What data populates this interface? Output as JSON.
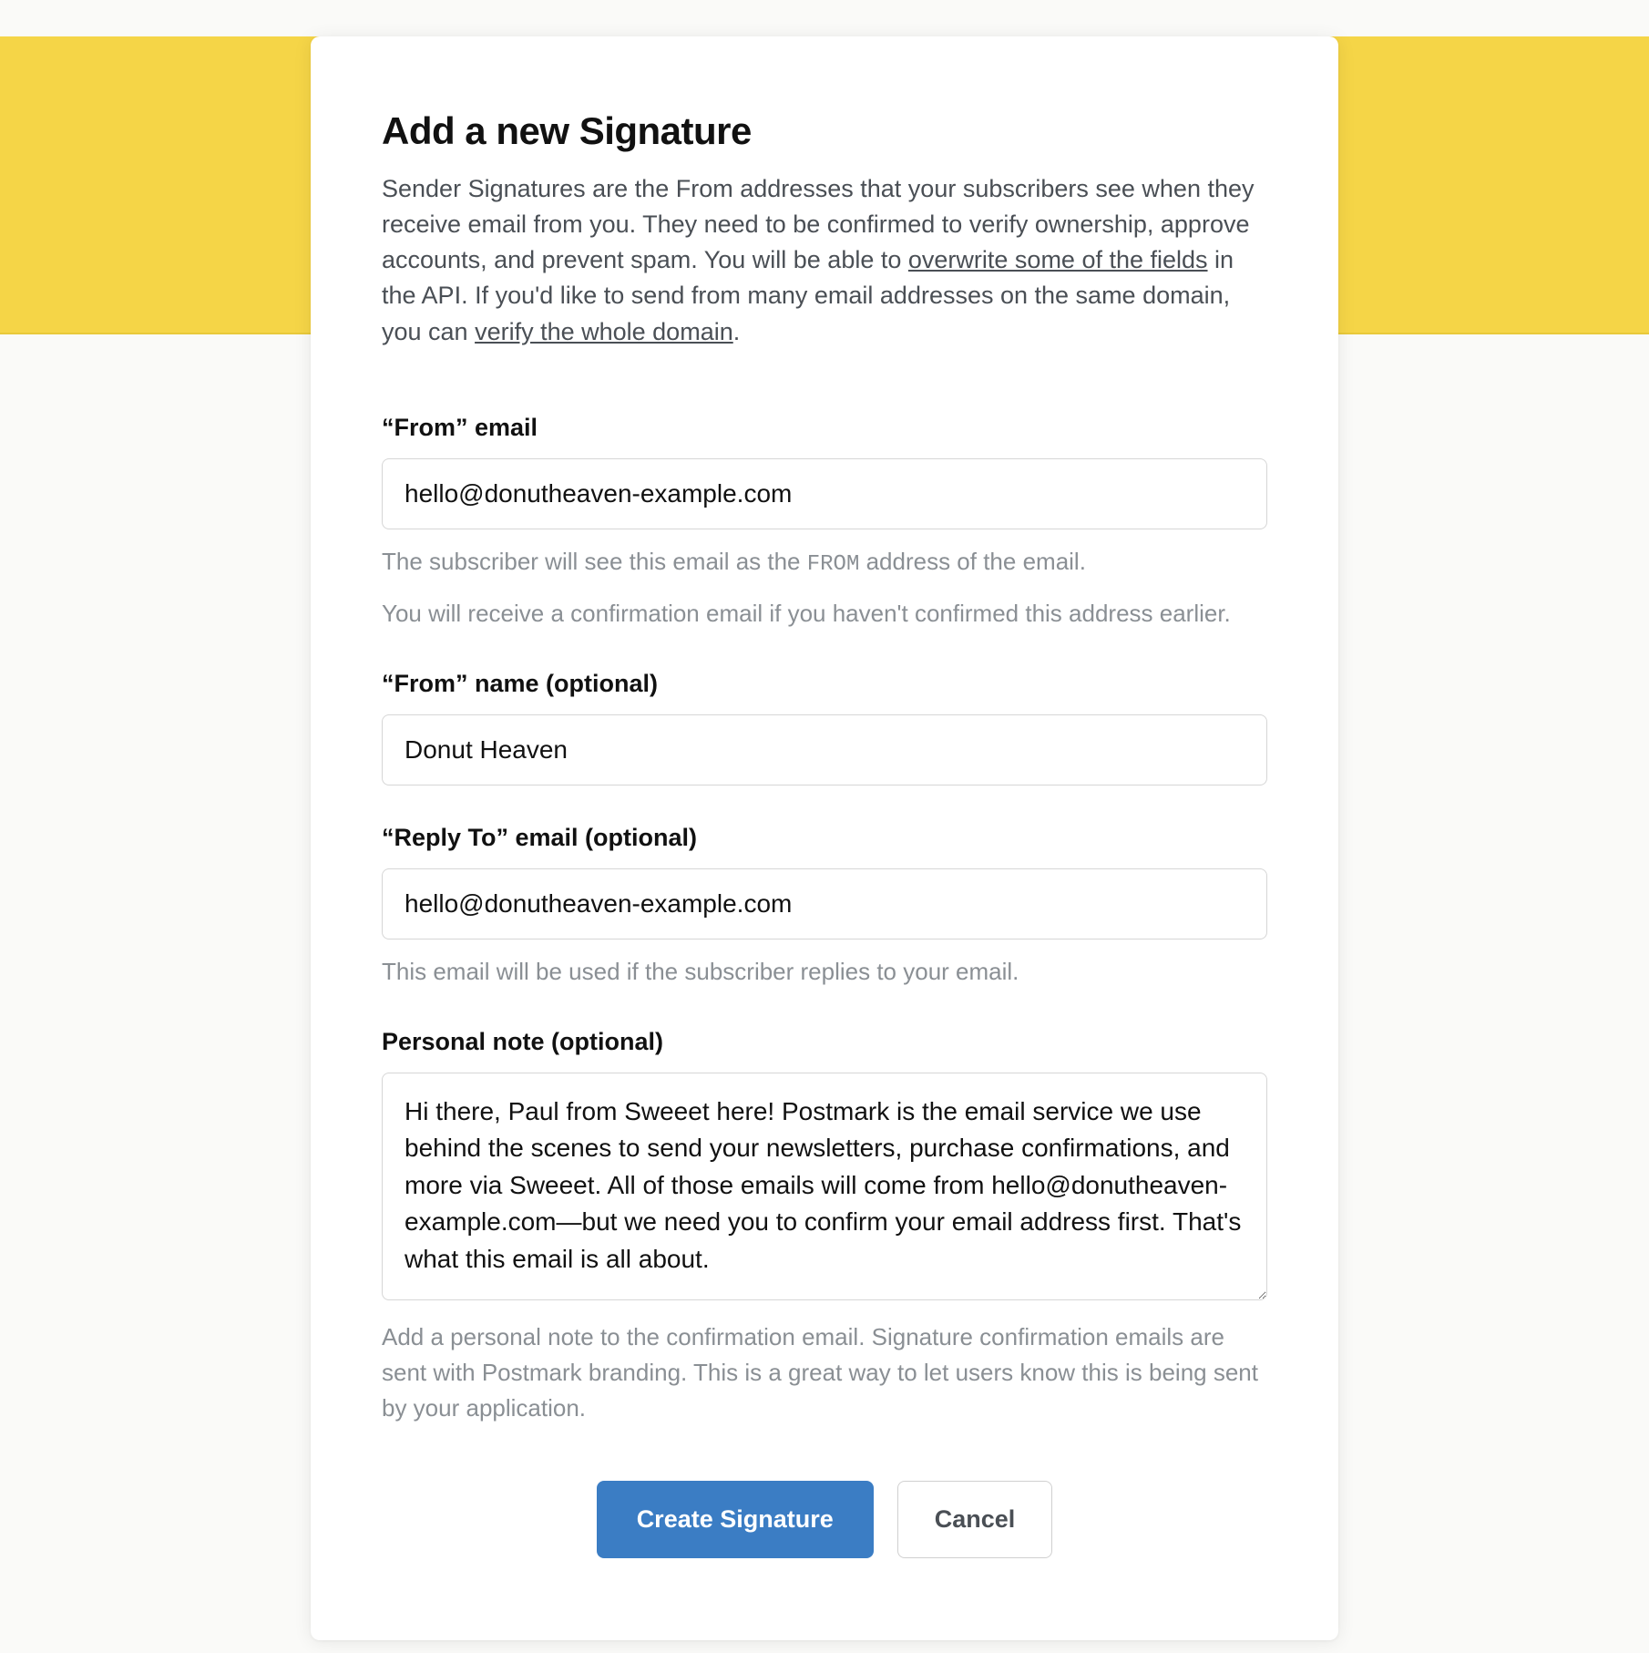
{
  "header": {
    "title": "Add a new Signature",
    "intro_prefix": "Sender Signatures are the From addresses that your subscribers see when they receive email from you. They need to be confirmed to verify ownership, approve accounts, and prevent spam. You will be able to ",
    "intro_link1": "overwrite some of the fields",
    "intro_mid": " in the API. If you'd like to send from many email addresses on the same domain, you can ",
    "intro_link2": "verify the whole domain",
    "intro_suffix": "."
  },
  "fields": {
    "from_email": {
      "label": "“From” email",
      "value": "hello@donutheaven-example.com",
      "help1_prefix": "The subscriber will see this email as the ",
      "help1_mono": "FROM",
      "help1_suffix": " address of the email.",
      "help2": "You will receive a confirmation email if you haven't confirmed this address earlier."
    },
    "from_name": {
      "label": "“From” name (optional)",
      "value": "Donut Heaven"
    },
    "reply_to": {
      "label": "“Reply To” email (optional)",
      "value": "hello@donutheaven-example.com",
      "help": "This email will be used if the subscriber replies to your email."
    },
    "personal_note": {
      "label": "Personal note (optional)",
      "value": "Hi there, Paul from Sweeet here! Postmark is the email service we use behind the scenes to send your newsletters, purchase confirmations, and more via Sweeet. All of those emails will come from hello@donutheaven-example.com—but we need you to confirm your email address first. That's what this email is all about.",
      "help": "Add a personal note to the confirmation email. Signature confirmation emails are sent with Postmark branding. This is a great way to let users know this is being sent by your application."
    }
  },
  "buttons": {
    "submit": "Create Signature",
    "cancel": "Cancel"
  }
}
